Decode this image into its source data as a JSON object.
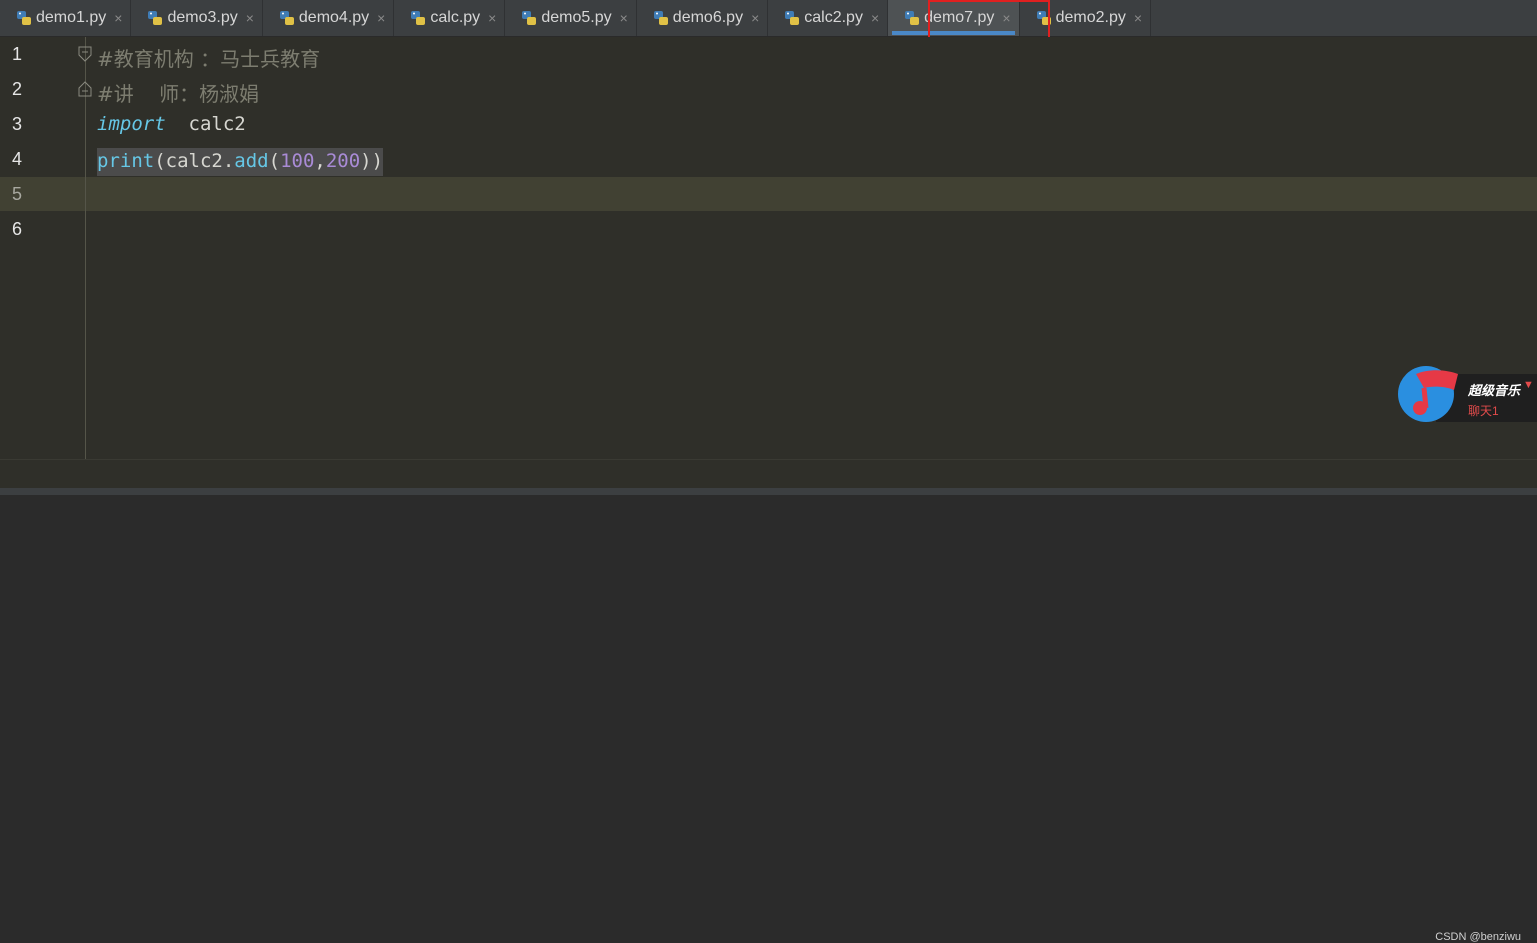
{
  "tabs": [
    {
      "label": "demo1.py",
      "active": false
    },
    {
      "label": "demo3.py",
      "active": false
    },
    {
      "label": "demo4.py",
      "active": false
    },
    {
      "label": "calc.py",
      "active": false
    },
    {
      "label": "demo5.py",
      "active": false
    },
    {
      "label": "demo6.py",
      "active": false
    },
    {
      "label": "calc2.py",
      "active": false
    },
    {
      "label": "demo7.py",
      "active": true
    },
    {
      "label": "demo2.py",
      "active": false
    }
  ],
  "close_glyph": "×",
  "editor": {
    "lines": [
      {
        "num": "1",
        "comment": "#教育机构 ：马士兵教育"
      },
      {
        "num": "2",
        "comment": "#讲    师：杨淑娟"
      },
      {
        "num": "3",
        "keyword": "import",
        "text": "  calc2"
      },
      {
        "num": "4",
        "func": "print",
        "p1": "(calc2.",
        "method": "add",
        "p2": "(",
        "n1": "100",
        "comma": ",",
        "n2": "200",
        "p3": "))"
      },
      {
        "num": "5"
      },
      {
        "num": "6"
      }
    ]
  },
  "widget": {
    "title": "超级音乐",
    "subtitle": "聊天1",
    "arrow": "▼"
  },
  "watermark": "CSDN @benziwu",
  "colors": {
    "accent": "#4a88c7",
    "highlight_box": "#e02020",
    "keyword": "#66c7e6",
    "number": "#a98bd6",
    "comment": "#7d7d70"
  }
}
